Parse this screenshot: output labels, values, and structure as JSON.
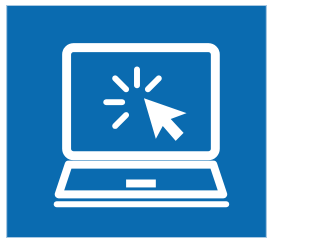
{
  "icon": {
    "name": "laptop-click-icon",
    "background_color": "#0a6bb0",
    "foreground_color": "#ffffff"
  }
}
